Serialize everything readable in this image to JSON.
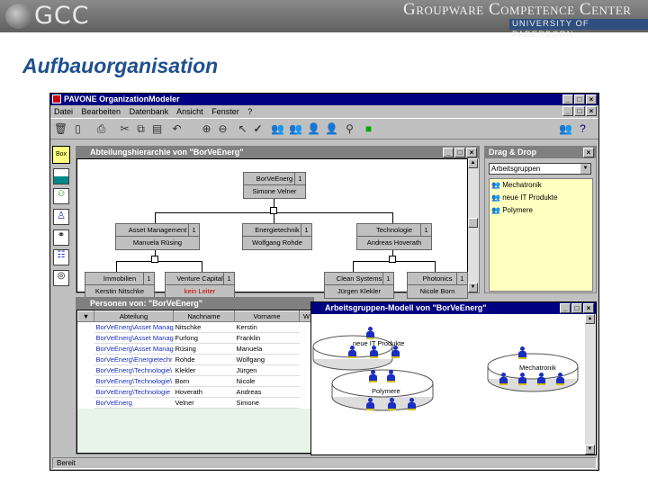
{
  "header": {
    "brand": "GCC",
    "name": "Groupware Competence Center",
    "university": "UNIVERSITY OF PADERBORN"
  },
  "slide_title": "Aufbauorganisation",
  "app": {
    "title": "PAVONE OrganizationModeler",
    "menu": [
      "Datei",
      "Bearbeiten",
      "Datenbank",
      "Ansicht",
      "Fenster",
      "?"
    ],
    "status": "Bereit"
  },
  "palette": {
    "label": "Box"
  },
  "hierarchy": {
    "title": "Abteilungshierarchie von \"BorVeEnerg\"",
    "root": {
      "name": "BorVeEnerg",
      "num": "1",
      "person": "Simone Velner"
    },
    "level1": [
      {
        "name": "Asset Management",
        "num": "1",
        "person": "Manuela Rüsing"
      },
      {
        "name": "Energietechnik",
        "num": "1",
        "person": "Wolfgang Rohde"
      },
      {
        "name": "Technologie",
        "num": "1",
        "person": "Andreas Hoverath"
      }
    ],
    "level2": [
      {
        "name": "Immobilien",
        "num": "1",
        "person": "Kerstin Nitschke"
      },
      {
        "name": "Venture Capital",
        "num": "1",
        "person": "kein Leiter"
      },
      {
        "name": "Clean Systems",
        "num": "1",
        "person": "Jürgen Klekler"
      },
      {
        "name": "Photonics",
        "num": "1",
        "person": "Nicole Born"
      }
    ]
  },
  "dragdrop": {
    "title": "Drag & Drop",
    "selected": "Arbeitsgruppen",
    "items": [
      "Mechatronik",
      "neue IT Produkte",
      "Polymere"
    ]
  },
  "persons": {
    "title": "Personen von: \"BorVeEnerg\"",
    "columns": [
      "Abteilung",
      "Nachname",
      "Vorname",
      "W"
    ],
    "rows": [
      [
        "BorVeEnerg\\Asset Manag",
        "Nitschke",
        "Kerstin"
      ],
      [
        "BorVeEnerg\\Asset Manag",
        "Furlong",
        "Franklin"
      ],
      [
        "BorVeEnerg\\Asset Manag",
        "Rüsing",
        "Manuela"
      ],
      [
        "BorVeEnerg\\Energietechr",
        "Rohde",
        "Wolfgang"
      ],
      [
        "BorVeEnerg\\Technologie\\",
        "Klekler",
        "Jürgen"
      ],
      [
        "BorVeEnerg\\Technologie\\",
        "Born",
        "Nicole"
      ],
      [
        "BorVeEnerg\\Technologie",
        "Hoverath",
        "Andreas"
      ],
      [
        "BorVeEnerg",
        "Velner",
        "Simone"
      ]
    ]
  },
  "groups": {
    "title": "Arbeitsgruppen-Modell von \"BorVeEnerg\"",
    "discs": [
      "neue IT Produkte",
      "Mechatronik",
      "Polymere"
    ]
  },
  "colors": {
    "titlebar": "#000080",
    "highlight": "#ffffc0",
    "link": "#1a2fbf",
    "warning": "#cc0000"
  }
}
